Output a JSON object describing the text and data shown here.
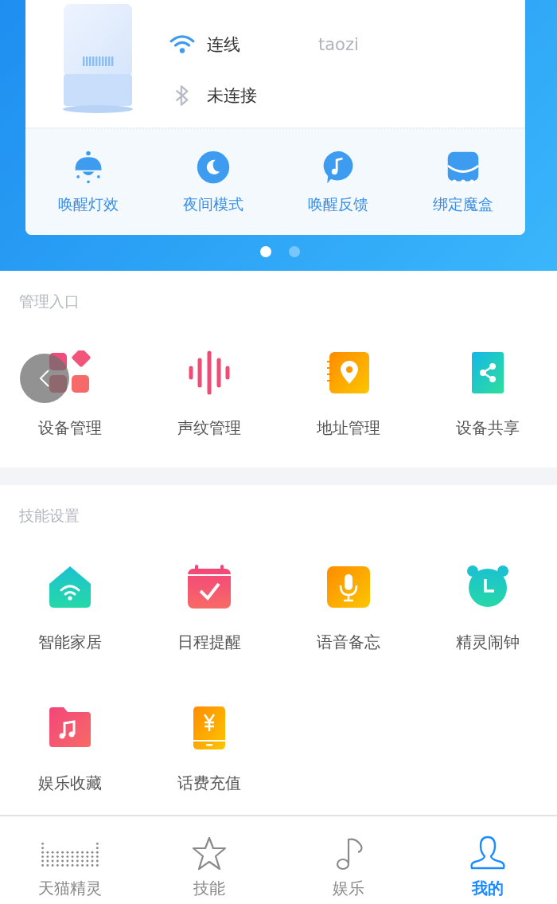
{
  "device": {
    "connections": [
      {
        "kind": "wifi",
        "label": "连线",
        "network": "taozi",
        "connected": true
      },
      {
        "kind": "bluetooth",
        "label": "未连接",
        "connected": false
      }
    ]
  },
  "quick_actions": [
    {
      "kind": "lamp",
      "label": "唤醒灯效"
    },
    {
      "kind": "moon",
      "label": "夜间模式"
    },
    {
      "kind": "note-bubble",
      "label": "唤醒反馈"
    },
    {
      "kind": "box",
      "label": "绑定魔盒"
    }
  ],
  "pager": [
    {
      "selected": true
    },
    {
      "selected": false
    }
  ],
  "sections": [
    {
      "title": "管理入口",
      "items": [
        {
          "kind": "tiles",
          "label": "设备管理"
        },
        {
          "kind": "voiceprint",
          "label": "声纹管理"
        },
        {
          "kind": "address-book",
          "label": "地址管理"
        },
        {
          "kind": "share",
          "label": "设备共享"
        }
      ]
    },
    {
      "title": "技能设置",
      "items": [
        {
          "kind": "home",
          "label": "智能家居"
        },
        {
          "kind": "calendar",
          "label": "日程提醒"
        },
        {
          "kind": "mic",
          "label": "语音备忘"
        },
        {
          "kind": "alarm",
          "label": "精灵闹钟"
        },
        {
          "kind": "music-folder",
          "label": "娱乐收藏"
        },
        {
          "kind": "phone-yen",
          "label": "话费充值"
        }
      ]
    }
  ],
  "tabs": [
    {
      "kind": "dots",
      "label": "天猫精灵",
      "selected": false
    },
    {
      "kind": "star",
      "label": "技能",
      "selected": false
    },
    {
      "kind": "note",
      "label": "娱乐",
      "selected": false
    },
    {
      "kind": "person",
      "label": "我的",
      "selected": true
    }
  ]
}
